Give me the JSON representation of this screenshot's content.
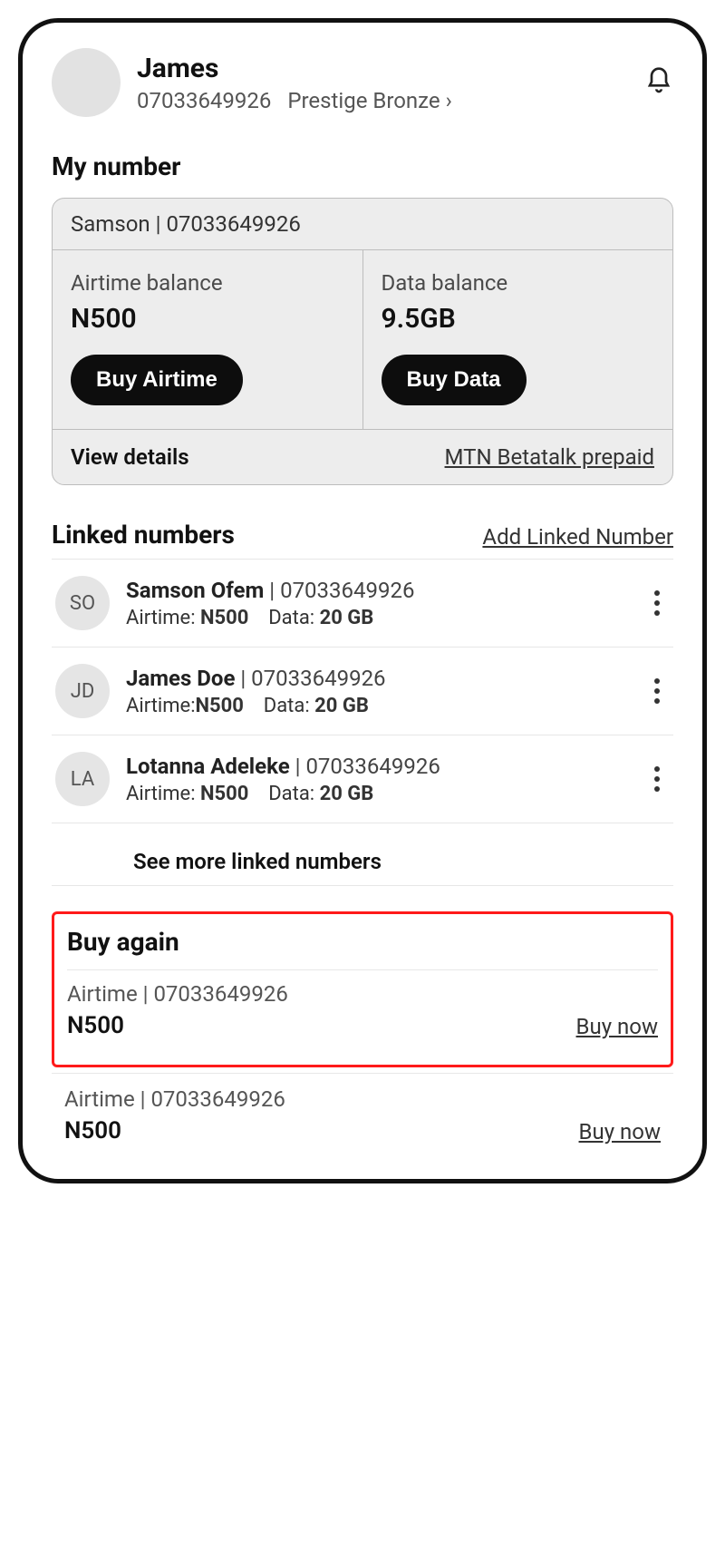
{
  "header": {
    "user_name": "James",
    "phone": "07033649926",
    "tier": "Prestige Bronze"
  },
  "my_number": {
    "section_title": "My number",
    "owner_line": "Samson | 07033649926",
    "airtime_label": "Airtime balance",
    "airtime_value": "N500",
    "airtime_button": "Buy Airtime",
    "data_label": "Data balance",
    "data_value": "9.5GB",
    "data_button": "Buy Data",
    "view_details": "View details",
    "plan_link": "MTN Betatalk prepaid"
  },
  "linked": {
    "title": "Linked numbers",
    "add_link": "Add Linked Number",
    "see_more": "See more linked numbers",
    "rows": [
      {
        "initials": "SO",
        "name": "Samson Ofem",
        "phone": "07033649926",
        "airtime": "N500",
        "data": "20 GB"
      },
      {
        "initials": "JD",
        "name": "James Doe",
        "phone": "07033649926",
        "airtime": "N500",
        "data": "20 GB"
      },
      {
        "initials": "LA",
        "name": "Lotanna Adeleke",
        "phone": "07033649926",
        "airtime": "N500",
        "data": "20 GB"
      }
    ]
  },
  "buy_again": {
    "title": "Buy again",
    "buy_now": "Buy now",
    "items": [
      {
        "type": "Airtime",
        "phone": "07033649926",
        "amount": "N500"
      },
      {
        "type": "Airtime",
        "phone": "07033649926",
        "amount": "N500"
      }
    ]
  },
  "labels": {
    "airtime_prefix": "Airtime:",
    "data_prefix": "Data:"
  }
}
